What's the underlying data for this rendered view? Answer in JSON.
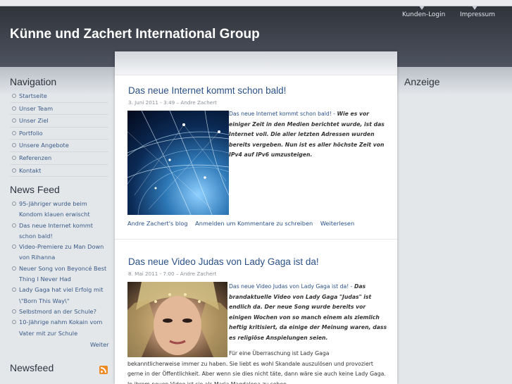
{
  "top_links": {
    "login": "Kunden-Login",
    "impressum": "Impressum"
  },
  "site_title": "Künne und Zachert International Group",
  "sidebar": {
    "nav_heading": "Navigation",
    "nav_items": [
      "Startseite",
      "Unser Team",
      "Unser Ziel",
      "Portfolio",
      "Unsere Angebote",
      "Referenzen",
      "Kontakt"
    ],
    "news_heading": "News Feed",
    "news_items": [
      "95-Jähriger wurde beim Kondom klauen erwischt",
      "Das neue Internet kommt schon bald!",
      "Video-Premiere zu Man Down von Rihanna",
      "Neuer Song von Beyoncé Best Thing I Never Had",
      "Lady Gaga hat viel Erfolg mit \\\"Born This Way\\\"",
      "Selbstmord an der Schule?",
      "10-Jährige nahm Kokain vom Vater mit zur Schule"
    ],
    "more": "Weiter",
    "newsfeed_heading": "Newsfeed"
  },
  "right": {
    "heading": "Anzeige"
  },
  "article1": {
    "title": "Das neue Internet kommt schon bald!",
    "meta": "3. Juni 2011 - 3:49 – Andre Zachert",
    "lead": "Das neue Internet kommt schon bald! - ",
    "bold": "Wie es vor einiger Zeit in den Medien berichtet wurde, ist das Internet voll. Die aller letzten Adressen wurden bereits vergeben. Nun ist es aller höchste Zeit von IPv4 auf IPv6 umzusteigen.",
    "links": {
      "blog": "Andre Zachert's blog",
      "login": "Anmelden um Kommentare zu schreiben",
      "more": "Weiterlesen"
    }
  },
  "article2": {
    "title": "Das neue Video Judas von Lady Gaga ist da!",
    "meta": "8. Mai 2011 - 7:00 – Andre Zachert",
    "lead": "Das neue Video Judas von Lady Gaga ist da! - ",
    "bold": "Das brandaktuelle Video von Lady Gaga \"Judas\" ist endlich da. Der neue Song wurde bereits vor einigen Wochen von so manch einem als ziemlich heftig kritisiert, da einige der Meinung waren, dass es religiöse Anspielungen seien.",
    "body_l1": "Für eine Überraschung ist Lady Gaga",
    "body_rest": "bekanntlicherweise immer zu haben. Sie liebt es wohl Skandale auszulösen und provoziert gerne in der Öffentlichkeit. Aber wenn sie dies nicht täte, dann wäre sie auch keine Lady Gaga. In ihrem neuen Video ist sie als Maria Magdalena zu sehen."
  },
  "colors": {
    "header": "#3b4049",
    "link": "#2b5187",
    "title_text": "#ffffff",
    "rss": "#f08a24"
  }
}
